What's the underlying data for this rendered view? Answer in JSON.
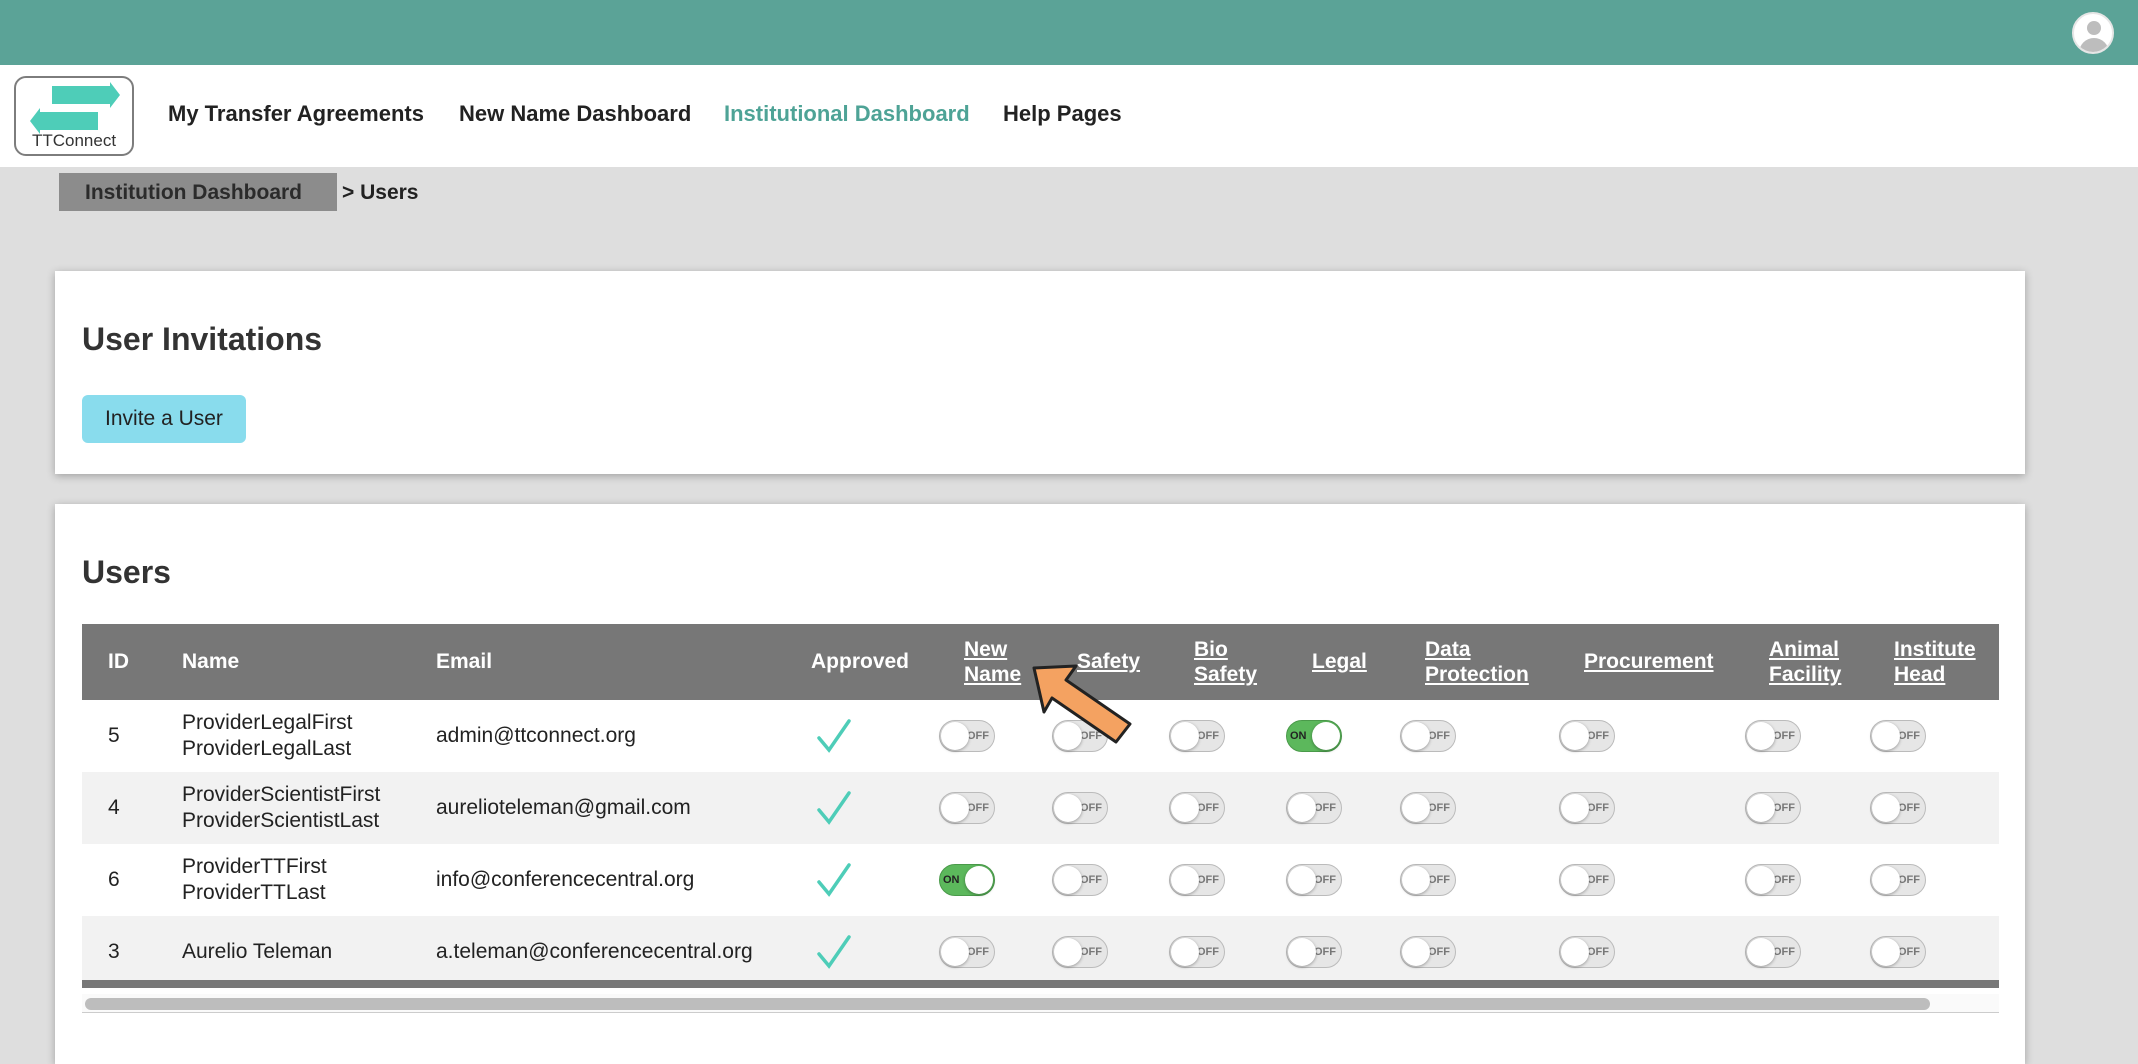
{
  "nav": {
    "logo_text": "TTConnect",
    "items": [
      {
        "label": "My Transfer Agreements",
        "active": false
      },
      {
        "label": "New Name Dashboard",
        "active": false
      },
      {
        "label": "Institutional Dashboard",
        "active": true
      },
      {
        "label": "Help Pages",
        "active": false
      }
    ]
  },
  "breadcrumb": {
    "root": "Institution Dashboard",
    "current": "> Users"
  },
  "invitations": {
    "title": "User Invitations",
    "invite_button": "Invite a User"
  },
  "users": {
    "title": "Users",
    "columns": [
      {
        "label": "ID",
        "sortable": false
      },
      {
        "label": "Name",
        "sortable": false
      },
      {
        "label": "Email",
        "sortable": false
      },
      {
        "label": "Approved",
        "sortable": false
      },
      {
        "label": "New Name",
        "sortable": true
      },
      {
        "label": "Safety",
        "sortable": true
      },
      {
        "label": "Bio Safety",
        "sortable": true
      },
      {
        "label": "Legal",
        "sortable": true
      },
      {
        "label": "Data Protection",
        "sortable": true
      },
      {
        "label": "Procurement",
        "sortable": true
      },
      {
        "label": "Animal Facility",
        "sortable": true
      },
      {
        "label": "Institute Head",
        "sortable": true
      }
    ],
    "toggle_on_label": "ON",
    "toggle_off_label": "OFF",
    "rows": [
      {
        "id": "5",
        "name": [
          "ProviderLegalFirst",
          "ProviderLegalLast"
        ],
        "email": "admin@ttconnect.org",
        "approved": true,
        "roles": [
          false,
          false,
          false,
          true,
          false,
          false,
          false,
          false
        ]
      },
      {
        "id": "4",
        "name": [
          "ProviderScientistFirst",
          "ProviderScientistLast"
        ],
        "email": "aurelioteleman@gmail.com",
        "approved": true,
        "roles": [
          false,
          false,
          false,
          false,
          false,
          false,
          false,
          false
        ]
      },
      {
        "id": "6",
        "name": [
          "ProviderTTFirst",
          "ProviderTTLast"
        ],
        "email": "info@conferencecentral.org",
        "approved": true,
        "roles": [
          true,
          false,
          false,
          false,
          false,
          false,
          false,
          false
        ]
      },
      {
        "id": "3",
        "name": [
          "Aurelio Teleman"
        ],
        "email": "a.teleman@conferencecentral.org",
        "approved": true,
        "roles": [
          false,
          false,
          false,
          false,
          false,
          false,
          false,
          false
        ]
      }
    ]
  },
  "colors": {
    "topbar": "#5ba397",
    "active_nav": "#4ea396",
    "invite_button": "#89dced",
    "toggle_on": "#5cb85c",
    "check": "#4ecdb8"
  },
  "icons": [
    "user-avatar-icon",
    "transfer-arrows-icon",
    "checkmark-icon",
    "pointer-arrow-icon"
  ]
}
